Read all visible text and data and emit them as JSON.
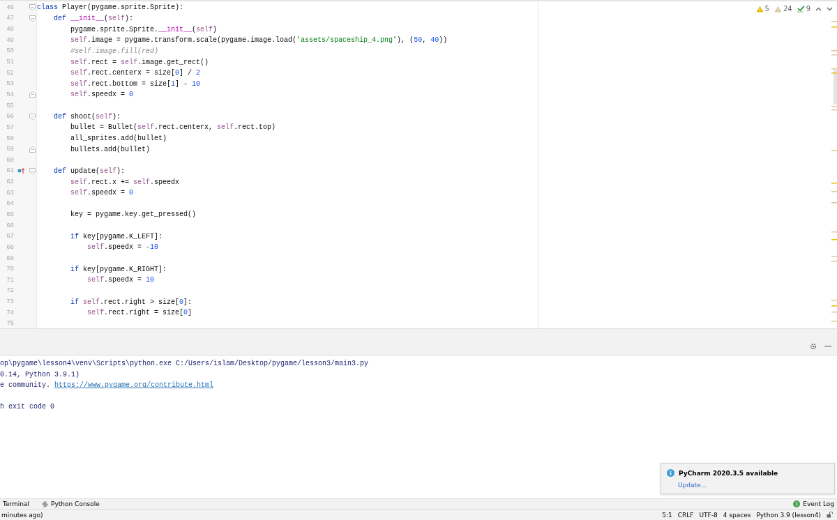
{
  "editor": {
    "lines": [
      {
        "number": "46",
        "fold_start": true,
        "tokens": [
          {
            "kind": "keyword",
            "text": "class"
          },
          {
            "kind": "plain",
            "text": " Player(pygame.sprite.Sprite):"
          }
        ]
      },
      {
        "number": "47",
        "fold_start": true,
        "tokens": [
          {
            "kind": "keyword",
            "text": "    def"
          },
          {
            "kind": "dunder",
            "text": " __init__"
          },
          {
            "kind": "plain",
            "text": "("
          },
          {
            "kind": "self",
            "text": "self"
          },
          {
            "kind": "plain",
            "text": "):"
          }
        ]
      },
      {
        "number": "48",
        "tokens": [
          {
            "kind": "plain",
            "text": "        pygame.sprite.Sprite."
          },
          {
            "kind": "dunder",
            "text": "__init__"
          },
          {
            "kind": "plain",
            "text": "("
          },
          {
            "kind": "self",
            "text": "self"
          },
          {
            "kind": "plain",
            "text": ")"
          }
        ]
      },
      {
        "number": "49",
        "tokens": [
          {
            "kind": "self",
            "text": "        self"
          },
          {
            "kind": "plain",
            "text": ".image = pygame.transform.scale(pygame.image.load("
          },
          {
            "kind": "string",
            "text": "'assets/spaceship_4.png'"
          },
          {
            "kind": "plain",
            "text": "), ("
          },
          {
            "kind": "number",
            "text": "50"
          },
          {
            "kind": "plain",
            "text": ", "
          },
          {
            "kind": "number",
            "text": "40"
          },
          {
            "kind": "plain",
            "text": "))"
          }
        ]
      },
      {
        "number": "50",
        "tokens": [
          {
            "kind": "comment",
            "text": "        #self.image.fill(red)"
          }
        ]
      },
      {
        "number": "51",
        "tokens": [
          {
            "kind": "self",
            "text": "        self"
          },
          {
            "kind": "plain",
            "text": ".rect = "
          },
          {
            "kind": "self",
            "text": "self"
          },
          {
            "kind": "plain",
            "text": ".image.get_rect()"
          }
        ]
      },
      {
        "number": "52",
        "tokens": [
          {
            "kind": "self",
            "text": "        self"
          },
          {
            "kind": "plain",
            "text": ".rect.centerx = size["
          },
          {
            "kind": "number",
            "text": "0"
          },
          {
            "kind": "plain",
            "text": "] / "
          },
          {
            "kind": "number",
            "text": "2"
          }
        ]
      },
      {
        "number": "53",
        "tokens": [
          {
            "kind": "self",
            "text": "        self"
          },
          {
            "kind": "plain",
            "text": ".rect.bottom = size["
          },
          {
            "kind": "number",
            "text": "1"
          },
          {
            "kind": "plain",
            "text": "] - "
          },
          {
            "kind": "number",
            "text": "10"
          }
        ]
      },
      {
        "number": "54",
        "fold_end": true,
        "tokens": [
          {
            "kind": "self",
            "text": "        self"
          },
          {
            "kind": "plain",
            "text": ".speedx = "
          },
          {
            "kind": "number",
            "text": "0"
          }
        ]
      },
      {
        "number": "55"
      },
      {
        "number": "56",
        "fold_start": true,
        "tokens": [
          {
            "kind": "keyword",
            "text": "    def"
          },
          {
            "kind": "plain",
            "text": " shoot("
          },
          {
            "kind": "self",
            "text": "self"
          },
          {
            "kind": "plain",
            "text": "):"
          }
        ]
      },
      {
        "number": "57",
        "tokens": [
          {
            "kind": "plain",
            "text": "        bullet = Bullet("
          },
          {
            "kind": "self",
            "text": "self"
          },
          {
            "kind": "plain",
            "text": ".rect.centerx, "
          },
          {
            "kind": "self",
            "text": "self"
          },
          {
            "kind": "plain",
            "text": ".rect.top)"
          }
        ]
      },
      {
        "number": "58",
        "tokens": [
          {
            "kind": "plain",
            "text": "        all_sprites.add(bullet)"
          }
        ]
      },
      {
        "number": "59",
        "fold_end": true,
        "tokens": [
          {
            "kind": "plain",
            "text": "        bullets.add(bullet)"
          }
        ]
      },
      {
        "number": "60"
      },
      {
        "number": "61",
        "fold_start": true,
        "override": true,
        "tokens": [
          {
            "kind": "keyword",
            "text": "    def"
          },
          {
            "kind": "plain",
            "text": " update("
          },
          {
            "kind": "self",
            "text": "self"
          },
          {
            "kind": "plain",
            "text": "):"
          }
        ]
      },
      {
        "number": "62",
        "tokens": [
          {
            "kind": "self",
            "text": "        self"
          },
          {
            "kind": "plain",
            "text": ".rect.x += "
          },
          {
            "kind": "self",
            "text": "self"
          },
          {
            "kind": "plain",
            "text": ".speedx"
          }
        ]
      },
      {
        "number": "63",
        "tokens": [
          {
            "kind": "self",
            "text": "        self"
          },
          {
            "kind": "plain",
            "text": ".speedx = "
          },
          {
            "kind": "number",
            "text": "0"
          }
        ]
      },
      {
        "number": "64"
      },
      {
        "number": "65",
        "tokens": [
          {
            "kind": "plain",
            "text": "        key = pygame.key.get_pressed()"
          }
        ]
      },
      {
        "number": "66"
      },
      {
        "number": "67",
        "tokens": [
          {
            "kind": "keyword",
            "text": "        if"
          },
          {
            "kind": "plain",
            "text": " key[pygame.K_LEFT]:"
          }
        ]
      },
      {
        "number": "68",
        "tokens": [
          {
            "kind": "self",
            "text": "            self"
          },
          {
            "kind": "plain",
            "text": ".speedx = "
          },
          {
            "kind": "number",
            "text": "-10"
          }
        ]
      },
      {
        "number": "69"
      },
      {
        "number": "70",
        "tokens": [
          {
            "kind": "keyword",
            "text": "        if"
          },
          {
            "kind": "plain",
            "text": " key[pygame.K_RIGHT]:"
          }
        ]
      },
      {
        "number": "71",
        "tokens": [
          {
            "kind": "self",
            "text": "            self"
          },
          {
            "kind": "plain",
            "text": ".speedx = "
          },
          {
            "kind": "number",
            "text": "10"
          }
        ]
      },
      {
        "number": "72"
      },
      {
        "number": "73",
        "tokens": [
          {
            "kind": "keyword",
            "text": "        if"
          },
          {
            "kind": "self",
            "text": " self"
          },
          {
            "kind": "plain",
            "text": ".rect.right > size["
          },
          {
            "kind": "number",
            "text": "0"
          },
          {
            "kind": "plain",
            "text": "]:"
          }
        ]
      },
      {
        "number": "74",
        "tokens": [
          {
            "kind": "self",
            "text": "            self"
          },
          {
            "kind": "plain",
            "text": ".rect.right = size["
          },
          {
            "kind": "number",
            "text": "0"
          },
          {
            "kind": "plain",
            "text": "]"
          }
        ]
      },
      {
        "number": "75"
      }
    ],
    "inspections": [
      {
        "kind": "warning",
        "count": "5"
      },
      {
        "kind": "weak-warning",
        "count": "24"
      },
      {
        "kind": "typo",
        "count": "9"
      }
    ]
  },
  "console": {
    "lines": [
      {
        "parts": [
          {
            "kind": "text",
            "text": "op\\pygame\\lesson4\\venv\\Scripts\\python.exe C:/Users/islam/Desktop/pygame/lesson3/main3.py"
          }
        ]
      },
      {
        "parts": [
          {
            "kind": "text",
            "text": "0.14, Python 3.9.1)"
          }
        ]
      },
      {
        "parts": [
          {
            "kind": "text",
            "text": "e community."
          },
          {
            "kind": "link",
            "text": "https://www.pygame.org/contribute.html"
          }
        ]
      },
      {
        "gap_before": true,
        "parts": [
          {
            "kind": "text",
            "text": "h exit code 0"
          }
        ]
      }
    ]
  },
  "notification": {
    "title": "PyCharm 2020.3.5 available",
    "action": "Update..."
  },
  "tool_windows": [
    {
      "label": "Terminal",
      "icon": false
    },
    {
      "label": "Python Console",
      "icon": true
    }
  ],
  "event_log": {
    "label": "Event Log",
    "count": "1"
  },
  "status_bar": {
    "message": "minutes ago)",
    "items": [
      "5:1",
      "CRLF",
      "UTF-8",
      "4 spaces",
      "Python 3.9 (lesson4)"
    ]
  }
}
